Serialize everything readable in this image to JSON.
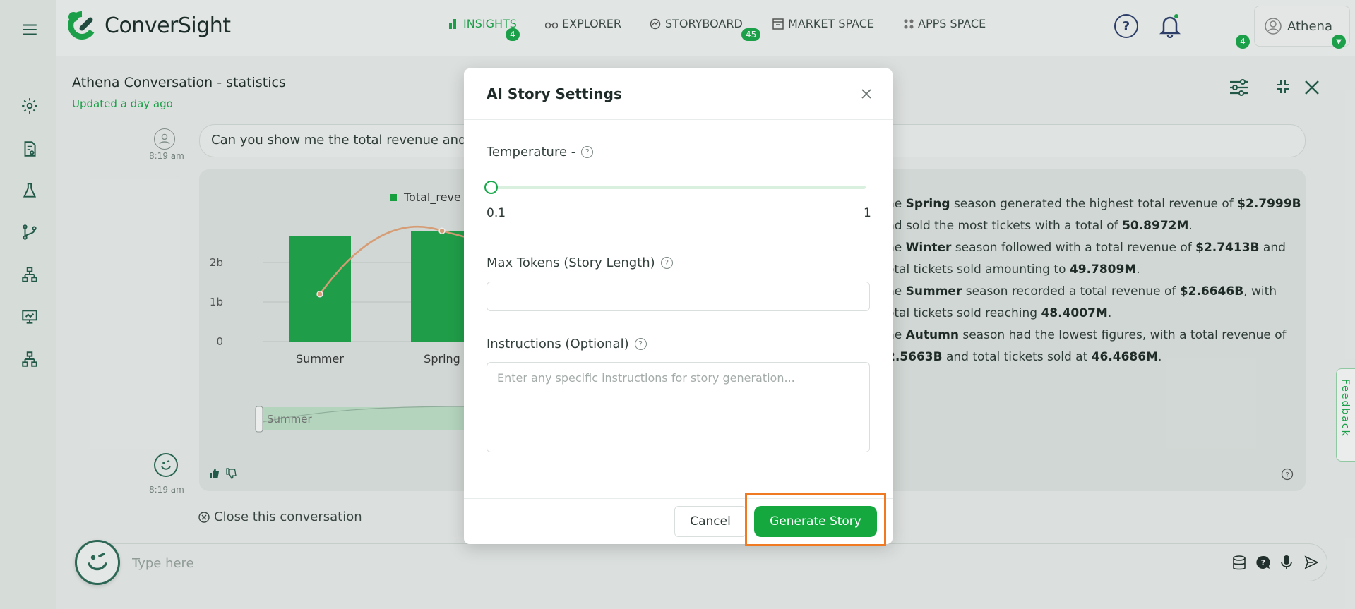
{
  "app": {
    "brand": "ConverSight"
  },
  "nav": {
    "insights": "INSIGHTS",
    "insights_badge": "4",
    "explorer": "EXPLORER",
    "storyboard": "STORYBOARD",
    "storyboard_badge": "45",
    "market_space": "MARKET SPACE",
    "apps_space": "APPS SPACE"
  },
  "header": {
    "notifications_count": "4",
    "user_name": "Athena"
  },
  "conversation": {
    "title": "Athena Conversation - statistics",
    "updated": "Updated a day ago",
    "question": "Can you show me the total revenue and",
    "question_time": "8:19 am",
    "answer_time": "8:19 am",
    "close_label": "Close this conversation"
  },
  "chart_data": {
    "type": "bar",
    "legend": "Total_reve",
    "categories": [
      "Summer",
      "Spring"
    ],
    "values": [
      2.6646,
      2.7999
    ],
    "line_values": [
      1.2,
      2.8
    ],
    "ytick_labels": [
      "0",
      "1b",
      "2b"
    ],
    "ylabel": "$",
    "brush_label": "Summer"
  },
  "story": [
    {
      "pre": "he ",
      "season": "Spring",
      "mid": " season generated the highest total revenue of ",
      "v1": "$2.7999B",
      "l2pre": "nd sold the most tickets with a total of ",
      "v2": "50.8972M",
      "end": "."
    },
    {
      "pre": "he ",
      "season": "Winter",
      "mid": " season followed with a total revenue of ",
      "v1": "$2.7413B",
      "mid2": " and",
      "l2pre": "otal tickets sold amounting to ",
      "v2": "49.7809M",
      "end": "."
    },
    {
      "pre": "he ",
      "season": "Summer",
      "mid": " season recorded a total revenue of ",
      "v1": "$2.6646B",
      "mid2": ", with",
      "l2pre": "otal tickets sold reaching ",
      "v2": "48.4007M",
      "end": "."
    },
    {
      "pre": "he ",
      "season": "Autumn",
      "mid": " season had the lowest figures, with a total revenue of",
      "v1": "2.5663B",
      "l2mid": " and total tickets sold at ",
      "v2": "46.4686M",
      "end": "."
    }
  ],
  "input": {
    "placeholder": "Type here"
  },
  "feedback": "Feedback",
  "modal": {
    "title": "AI Story Settings",
    "temperature_label": "Temperature -",
    "temperature_min": "0.1",
    "temperature_max": "1",
    "temperature_value": 0.1,
    "max_tokens_label": "Max Tokens (Story Length)",
    "max_tokens_value": "",
    "instructions_label": "Instructions (Optional)",
    "instructions_placeholder": "Enter any specific instructions for story generation...",
    "cancel": "Cancel",
    "generate": "Generate Story"
  },
  "colors": {
    "accent": "#14a83f",
    "highlight": "#ef7a23",
    "line": "#e8a57a"
  }
}
